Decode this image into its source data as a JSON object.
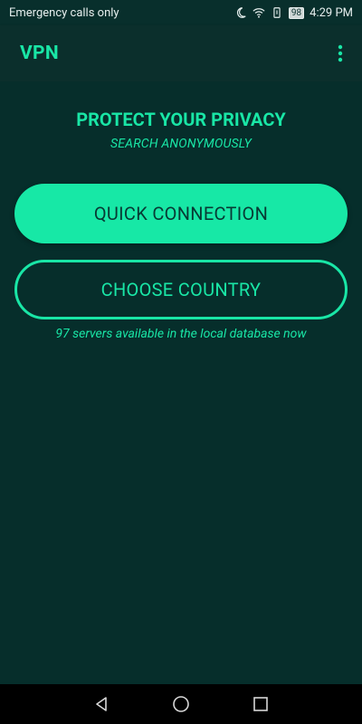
{
  "status_bar": {
    "left_text": "Emergency calls only",
    "battery": "98",
    "time": "4:29 PM",
    "icons": [
      "moon-icon",
      "wifi-icon",
      "vibrate-icon",
      "battery-icon"
    ]
  },
  "app_bar": {
    "title": "VPN",
    "overflow_icon": "overflow-menu-icon"
  },
  "main": {
    "headline": "PROTECT YOUR PRIVACY",
    "subline": "SEARCH ANONYMOUSLY",
    "quick_button": "QUICK CONNECTION",
    "country_button": "CHOOSE COUNTRY",
    "servers_note": "97 servers available in the local database now"
  },
  "nav_bar": {
    "icons": [
      "back-icon",
      "home-icon",
      "recents-icon"
    ]
  },
  "colors": {
    "background": "#062e2b",
    "accent": "#19e6a6",
    "button_text": "#083a34"
  }
}
